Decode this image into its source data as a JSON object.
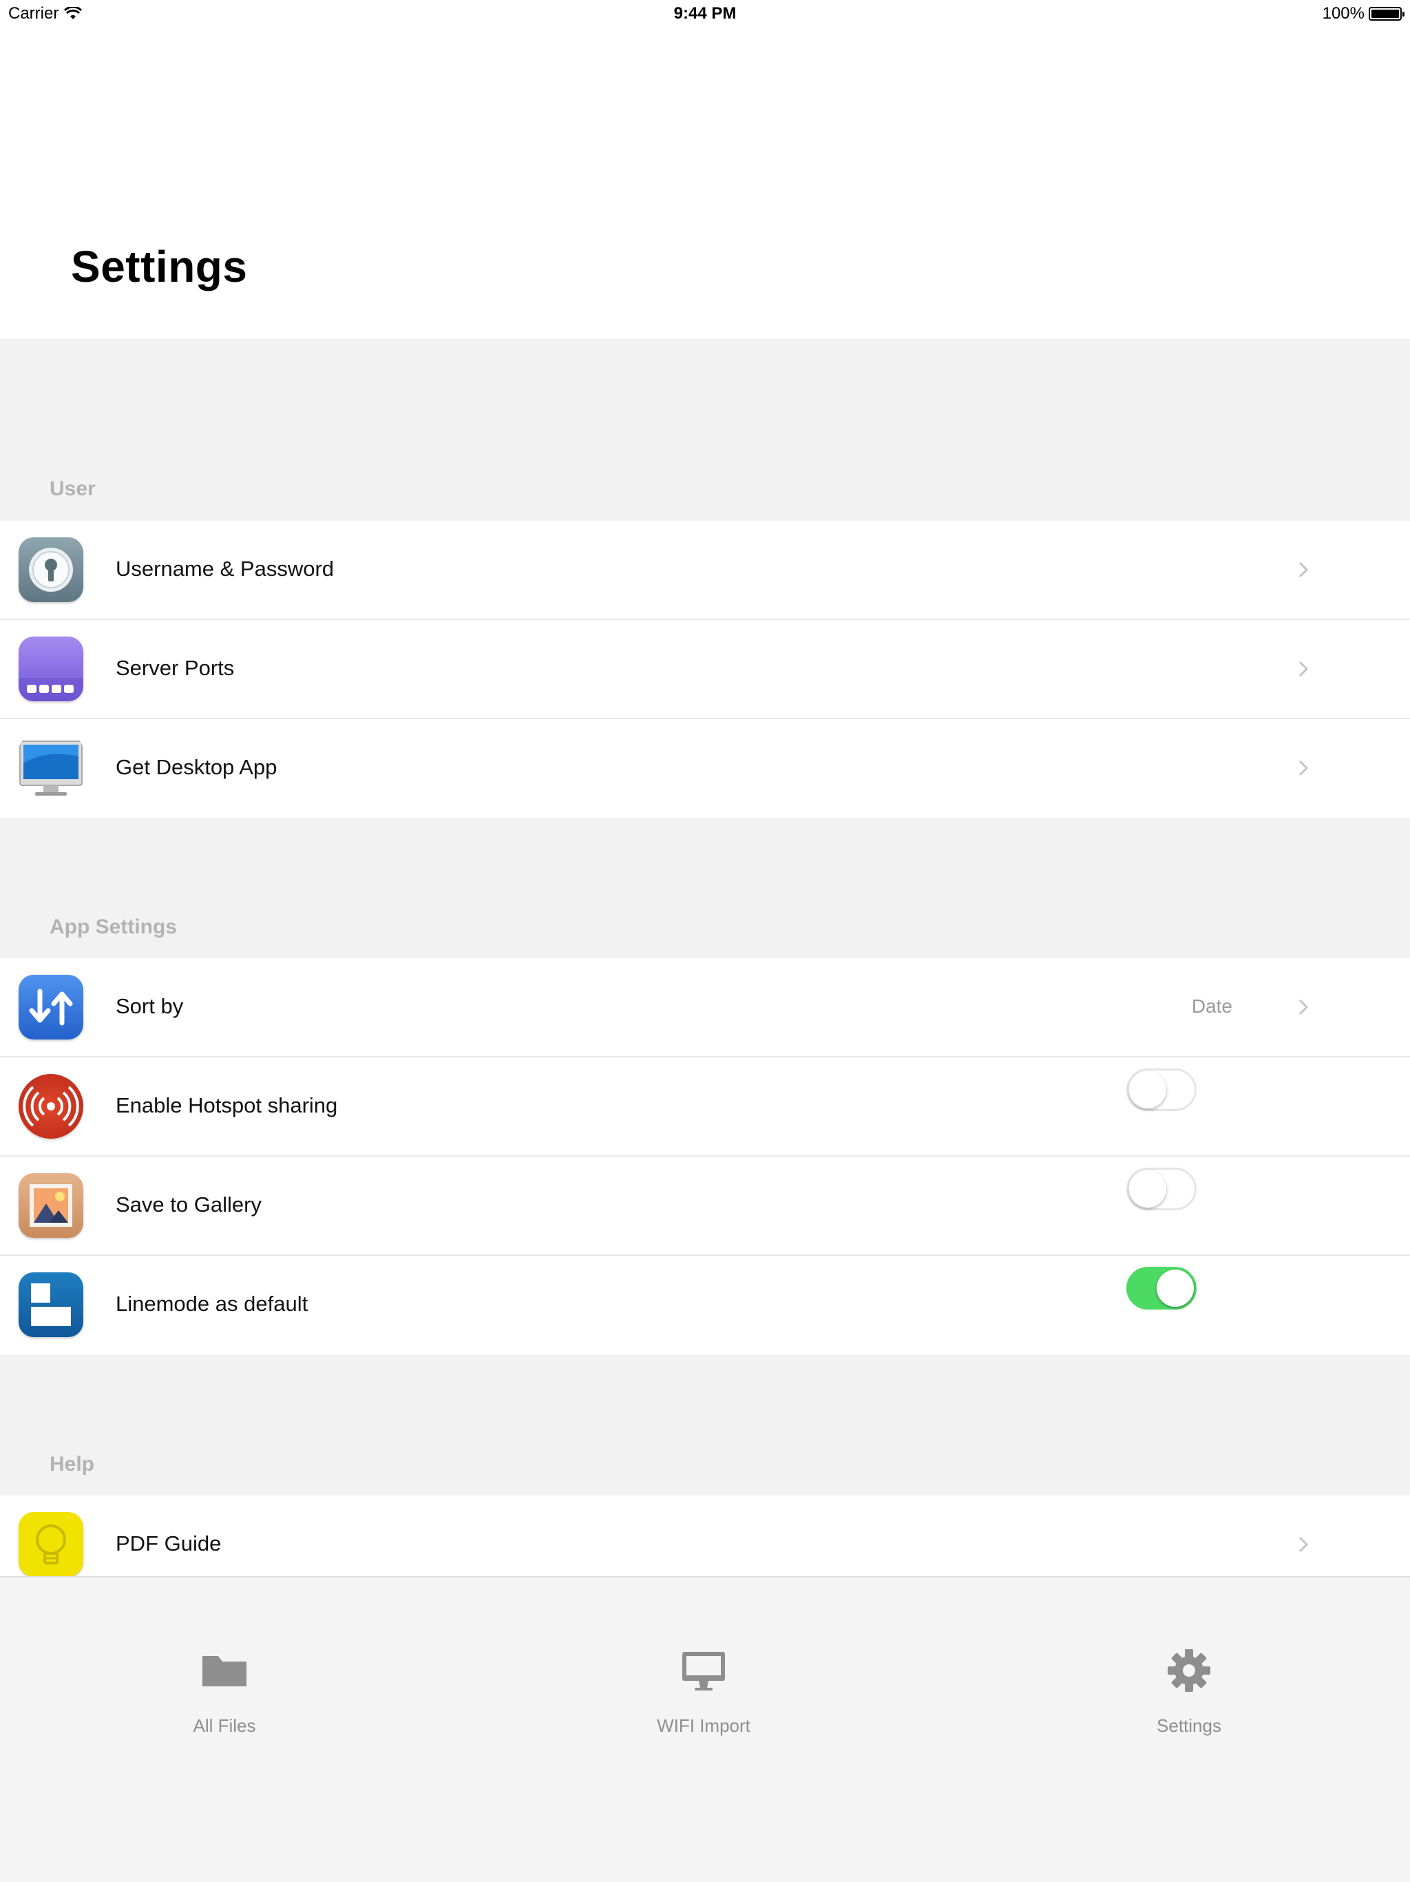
{
  "status_bar": {
    "carrier": "Carrier",
    "time": "9:44 PM",
    "battery": "100%"
  },
  "header": {
    "title": "Settings"
  },
  "sections": {
    "user": {
      "title": "User",
      "items": [
        {
          "label": "Username & Password",
          "icon": "key-icon"
        },
        {
          "label": "Server Ports",
          "icon": "server-ports-icon"
        },
        {
          "label": "Get Desktop App",
          "icon": "desktop-monitor-icon"
        }
      ]
    },
    "app_settings": {
      "title": "App Settings",
      "sort_by": {
        "label": "Sort by",
        "value": "Date",
        "icon": "sort-arrows-icon"
      },
      "hotspot": {
        "label": "Enable Hotspot sharing",
        "enabled": false,
        "icon": "hotspot-icon"
      },
      "gallery": {
        "label": "Save to Gallery",
        "enabled": false,
        "icon": "gallery-icon"
      },
      "linemode": {
        "label": "Linemode as default",
        "enabled": true,
        "icon": "linemode-icon"
      }
    },
    "help": {
      "title": "Help",
      "items": [
        {
          "label": "PDF Guide",
          "icon": "lightbulb-icon"
        }
      ]
    }
  },
  "tabs": [
    {
      "label": "All Files",
      "icon": "folder-icon"
    },
    {
      "label": "WIFI Import",
      "icon": "monitor-icon"
    },
    {
      "label": "Settings",
      "icon": "gear-icon"
    }
  ],
  "colors": {
    "toggle_on": "#4cd964",
    "section_header": "#b3b3b3",
    "tab_icon": "#8e8e8e"
  }
}
